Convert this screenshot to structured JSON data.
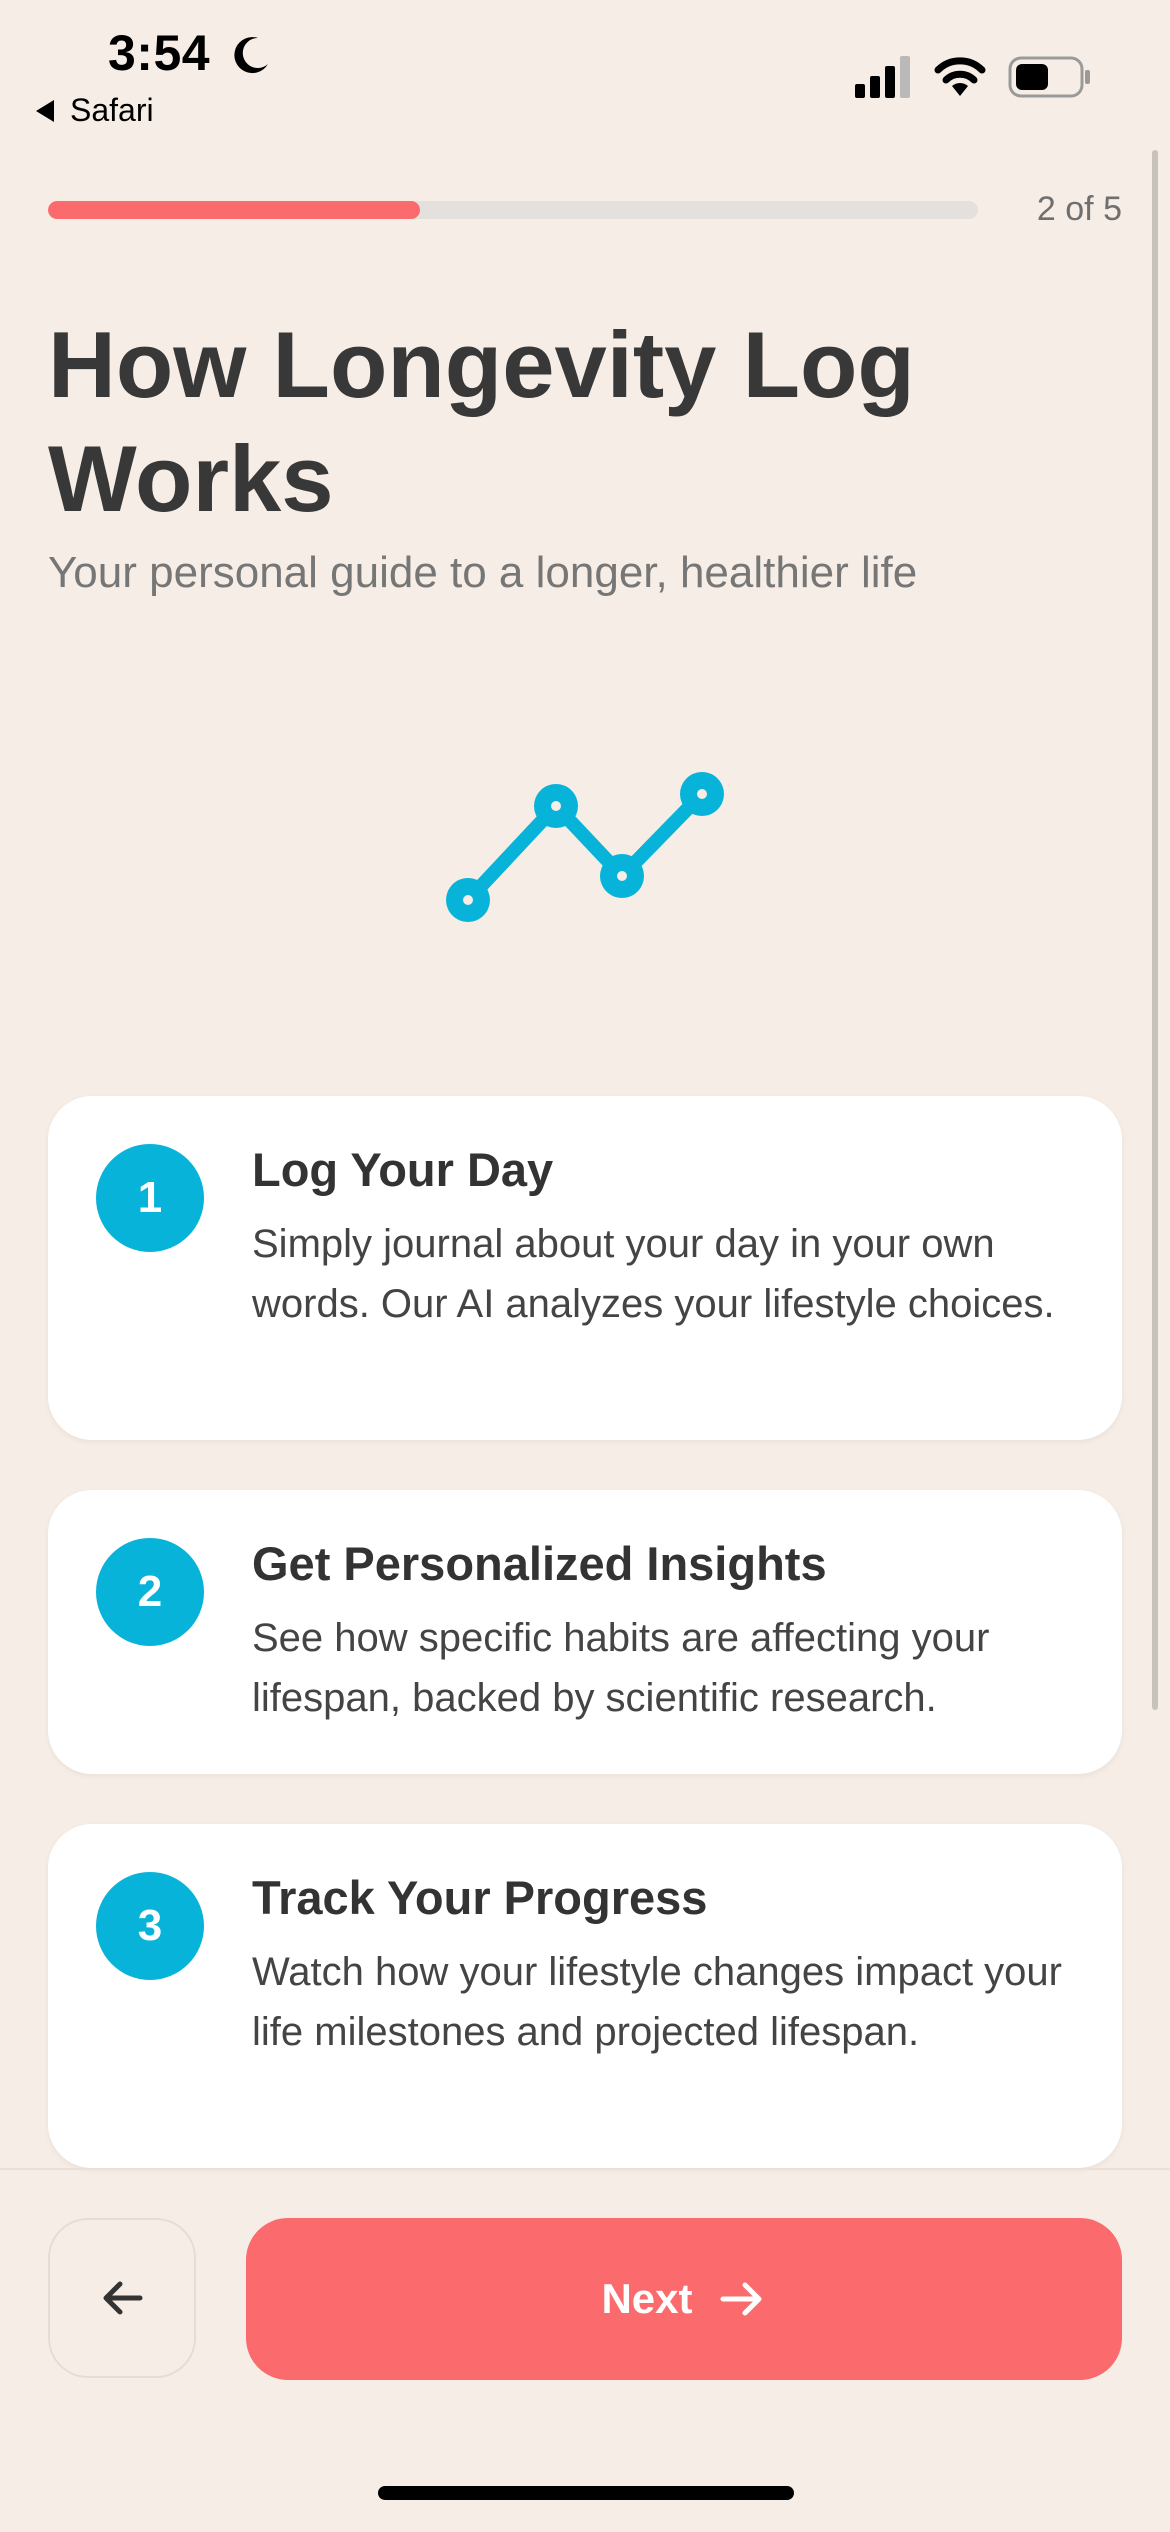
{
  "status_bar": {
    "time": "3:54",
    "back_app": "Safari",
    "icons": [
      "moon-icon",
      "signal-icon",
      "wifi-icon",
      "battery-icon"
    ]
  },
  "progress": {
    "label": "2 of 5",
    "fraction": 0.4,
    "fill_color": "#fb6b6d",
    "track_color": "#e3e0dd"
  },
  "header": {
    "title": "How Longevity Log Works",
    "subtitle": "Your personal guide to a longer, healthier life"
  },
  "illustration": {
    "icon": "trend-line-icon",
    "color": "#07b3d8"
  },
  "steps": [
    {
      "number": "1",
      "title": "Log Your Day",
      "description": "Simply journal about your day in your own words. Our AI analyzes your lifestyle choices."
    },
    {
      "number": "2",
      "title": "Get Personalized Insights",
      "description": "See how specific habits are affecting your lifespan, backed by scientific research."
    },
    {
      "number": "3",
      "title": "Track Your Progress",
      "description": "Watch how your lifestyle changes impact your life milestones and projected lifespan."
    }
  ],
  "footer": {
    "back_icon": "arrow-left-icon",
    "next_label": "Next",
    "next_icon": "arrow-right-icon",
    "accent": "#fb6b6d"
  }
}
